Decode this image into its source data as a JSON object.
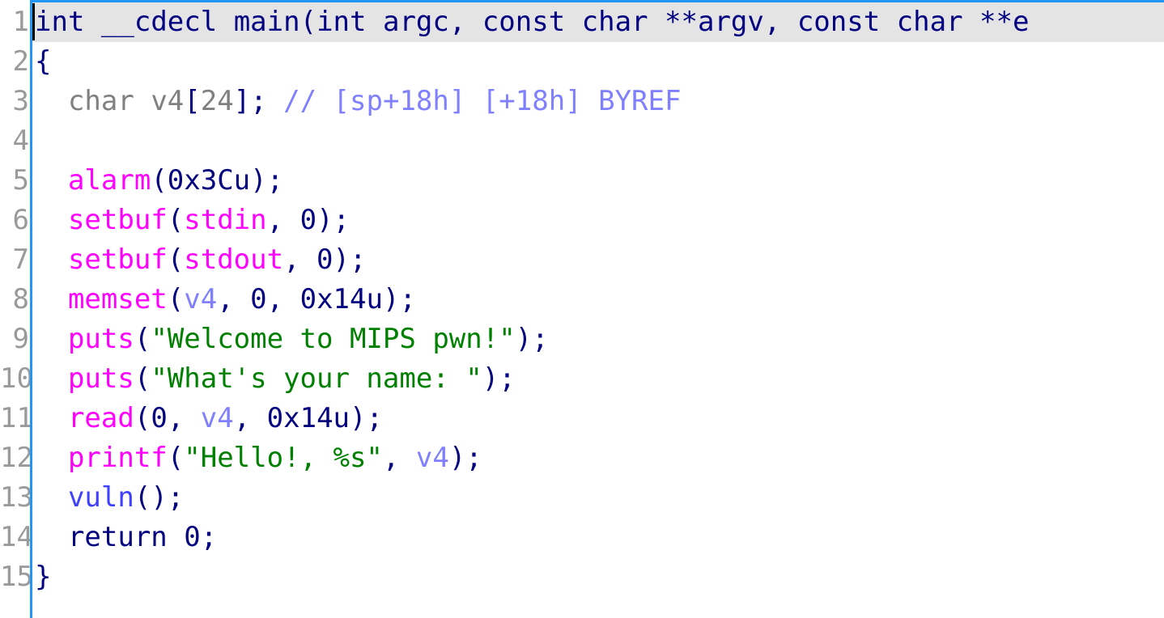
{
  "view": {
    "name": "hex-rays-pseudocode",
    "function_name": "main",
    "colors": {
      "background": "#ffffff",
      "current_line_highlight": "#e4e4e4",
      "border": "#2196f3",
      "line_number": "#9a9a9a",
      "keyword": "#000080",
      "type": "#808080",
      "local_variable": "#8080ff",
      "comment": "#8080ff",
      "library_function": "#ff00ff",
      "user_function": "#4040ff",
      "string_literal": "#008000",
      "caret": "#000000"
    }
  },
  "line_numbers": [
    "1",
    "2",
    "3",
    "4",
    "5",
    "6",
    "7",
    "8",
    "9",
    "10",
    "11",
    "12",
    "13",
    "14",
    "15"
  ],
  "code_lines": [
    {
      "number": "1",
      "current": true,
      "text": "int __cdecl main(int argc, const char **argv, const char **e",
      "tokens": [
        {
          "text": "int",
          "kind": "keyword"
        },
        {
          "text": " ",
          "kind": "punct"
        },
        {
          "text": "__cdecl",
          "kind": "keyword"
        },
        {
          "text": " ",
          "kind": "punct"
        },
        {
          "text": "main",
          "kind": "keyword"
        },
        {
          "text": "(",
          "kind": "punct"
        },
        {
          "text": "int",
          "kind": "keyword"
        },
        {
          "text": " ",
          "kind": "punct"
        },
        {
          "text": "argc",
          "kind": "keyword"
        },
        {
          "text": ", ",
          "kind": "punct"
        },
        {
          "text": "const",
          "kind": "keyword"
        },
        {
          "text": " ",
          "kind": "punct"
        },
        {
          "text": "char",
          "kind": "keyword"
        },
        {
          "text": " **",
          "kind": "punct"
        },
        {
          "text": "argv",
          "kind": "keyword"
        },
        {
          "text": ", ",
          "kind": "punct"
        },
        {
          "text": "const",
          "kind": "keyword"
        },
        {
          "text": " ",
          "kind": "punct"
        },
        {
          "text": "char",
          "kind": "keyword"
        },
        {
          "text": " **",
          "kind": "punct"
        },
        {
          "text": "e",
          "kind": "keyword"
        }
      ]
    },
    {
      "number": "2",
      "current": false,
      "text": "{",
      "tokens": [
        {
          "text": "{",
          "kind": "punct"
        }
      ]
    },
    {
      "number": "3",
      "current": false,
      "text": "  char v4[24]; // [sp+18h] [+18h] BYREF",
      "tokens": [
        {
          "text": "  ",
          "kind": "punct"
        },
        {
          "text": "char",
          "kind": "type"
        },
        {
          "text": " ",
          "kind": "punct"
        },
        {
          "text": "v4",
          "kind": "type"
        },
        {
          "text": "[",
          "kind": "punct"
        },
        {
          "text": "24",
          "kind": "type"
        },
        {
          "text": "]",
          "kind": "punct"
        },
        {
          "text": ";",
          "kind": "punct"
        },
        {
          "text": " ",
          "kind": "punct"
        },
        {
          "text": "// [sp+18h] [+18h] BYREF",
          "kind": "comment"
        }
      ]
    },
    {
      "number": "4",
      "current": false,
      "text": "",
      "tokens": []
    },
    {
      "number": "5",
      "current": false,
      "text": "  alarm(0x3Cu);",
      "tokens": [
        {
          "text": "  ",
          "kind": "punct"
        },
        {
          "text": "alarm",
          "kind": "libfunc"
        },
        {
          "text": "(",
          "kind": "punct"
        },
        {
          "text": "0x3Cu",
          "kind": "number"
        },
        {
          "text": ");",
          "kind": "punct"
        }
      ]
    },
    {
      "number": "6",
      "current": false,
      "text": "  setbuf(stdin, 0);",
      "tokens": [
        {
          "text": "  ",
          "kind": "punct"
        },
        {
          "text": "setbuf",
          "kind": "libfunc"
        },
        {
          "text": "(",
          "kind": "punct"
        },
        {
          "text": "stdin",
          "kind": "libfunc"
        },
        {
          "text": ", ",
          "kind": "punct"
        },
        {
          "text": "0",
          "kind": "number"
        },
        {
          "text": ");",
          "kind": "punct"
        }
      ]
    },
    {
      "number": "7",
      "current": false,
      "text": "  setbuf(stdout, 0);",
      "tokens": [
        {
          "text": "  ",
          "kind": "punct"
        },
        {
          "text": "setbuf",
          "kind": "libfunc"
        },
        {
          "text": "(",
          "kind": "punct"
        },
        {
          "text": "stdout",
          "kind": "libfunc"
        },
        {
          "text": ", ",
          "kind": "punct"
        },
        {
          "text": "0",
          "kind": "number"
        },
        {
          "text": ");",
          "kind": "punct"
        }
      ]
    },
    {
      "number": "8",
      "current": false,
      "text": "  memset(v4, 0, 0x14u);",
      "tokens": [
        {
          "text": "  ",
          "kind": "punct"
        },
        {
          "text": "memset",
          "kind": "libfunc"
        },
        {
          "text": "(",
          "kind": "punct"
        },
        {
          "text": "v4",
          "kind": "localvar"
        },
        {
          "text": ", ",
          "kind": "punct"
        },
        {
          "text": "0",
          "kind": "number"
        },
        {
          "text": ", ",
          "kind": "punct"
        },
        {
          "text": "0x14u",
          "kind": "number"
        },
        {
          "text": ");",
          "kind": "punct"
        }
      ]
    },
    {
      "number": "9",
      "current": false,
      "text": "  puts(\"Welcome to MIPS pwn!\");",
      "tokens": [
        {
          "text": "  ",
          "kind": "punct"
        },
        {
          "text": "puts",
          "kind": "libfunc"
        },
        {
          "text": "(",
          "kind": "punct"
        },
        {
          "text": "\"Welcome to MIPS pwn!\"",
          "kind": "string"
        },
        {
          "text": ");",
          "kind": "punct"
        }
      ]
    },
    {
      "number": "10",
      "current": false,
      "text": "  puts(\"What's your name: \");",
      "tokens": [
        {
          "text": "  ",
          "kind": "punct"
        },
        {
          "text": "puts",
          "kind": "libfunc"
        },
        {
          "text": "(",
          "kind": "punct"
        },
        {
          "text": "\"What's your name: \"",
          "kind": "string"
        },
        {
          "text": ");",
          "kind": "punct"
        }
      ]
    },
    {
      "number": "11",
      "current": false,
      "text": "  read(0, v4, 0x14u);",
      "tokens": [
        {
          "text": "  ",
          "kind": "punct"
        },
        {
          "text": "read",
          "kind": "libfunc"
        },
        {
          "text": "(",
          "kind": "punct"
        },
        {
          "text": "0",
          "kind": "number"
        },
        {
          "text": ", ",
          "kind": "punct"
        },
        {
          "text": "v4",
          "kind": "localvar"
        },
        {
          "text": ", ",
          "kind": "punct"
        },
        {
          "text": "0x14u",
          "kind": "number"
        },
        {
          "text": ");",
          "kind": "punct"
        }
      ]
    },
    {
      "number": "12",
      "current": false,
      "text": "  printf(\"Hello!, %s\", v4);",
      "tokens": [
        {
          "text": "  ",
          "kind": "punct"
        },
        {
          "text": "printf",
          "kind": "libfunc"
        },
        {
          "text": "(",
          "kind": "punct"
        },
        {
          "text": "\"Hello!, %s\"",
          "kind": "string"
        },
        {
          "text": ", ",
          "kind": "punct"
        },
        {
          "text": "v4",
          "kind": "localvar"
        },
        {
          "text": ");",
          "kind": "punct"
        }
      ]
    },
    {
      "number": "13",
      "current": false,
      "text": "  vuln();",
      "tokens": [
        {
          "text": "  ",
          "kind": "punct"
        },
        {
          "text": "vuln",
          "kind": "userfunc"
        },
        {
          "text": "();",
          "kind": "punct"
        }
      ]
    },
    {
      "number": "14",
      "current": false,
      "text": "  return 0;",
      "tokens": [
        {
          "text": "  ",
          "kind": "punct"
        },
        {
          "text": "return",
          "kind": "keyword"
        },
        {
          "text": " ",
          "kind": "punct"
        },
        {
          "text": "0",
          "kind": "number"
        },
        {
          "text": ";",
          "kind": "punct"
        }
      ]
    },
    {
      "number": "15",
      "current": false,
      "text": "}",
      "tokens": [
        {
          "text": "}",
          "kind": "punct"
        }
      ]
    }
  ]
}
